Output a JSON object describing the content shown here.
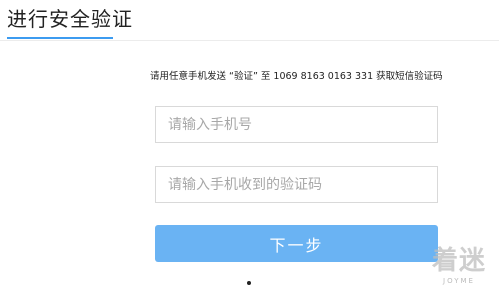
{
  "header": {
    "title": "进行安全验证"
  },
  "instruction": "请用任意手机发送 “验证” 至 1069 8163 0163 331 获取短信验证码",
  "form": {
    "phone_placeholder": "请输入手机号",
    "phone_value": "",
    "code_placeholder": "请输入手机收到的验证码",
    "code_value": "",
    "next_label": "下一步"
  },
  "colors": {
    "accent": "#3c9bf0",
    "button": "#6ab3f3"
  },
  "watermark": {
    "logo": "着迷",
    "subtitle": "JOYME"
  }
}
